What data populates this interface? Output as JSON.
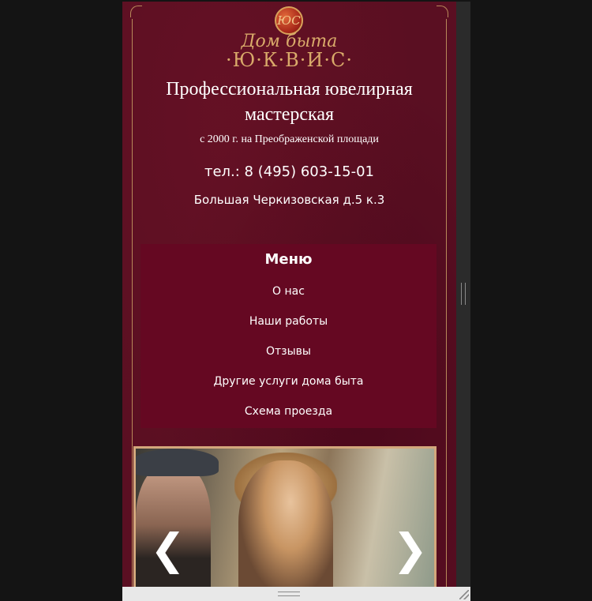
{
  "logo": {
    "monogram": "ЮС",
    "script_text": "Дом быта",
    "brand_text": "·Ю·К·В·И·С·"
  },
  "header": {
    "title": "Профессиональная ювелирная мастерская",
    "subtitle": "с 2000 г. на Преображенской площади",
    "phone": "тел.: 8 (495) 603-15-01",
    "address": "Большая Черкизовская д.5 к.3"
  },
  "menu": {
    "title": "Меню",
    "items": [
      {
        "label": "О нас"
      },
      {
        "label": "Наши работы"
      },
      {
        "label": "Отзывы"
      },
      {
        "label": "Другие услуги дома быта"
      },
      {
        "label": "Схема проезда"
      }
    ]
  },
  "slider": {
    "prev_glyph": "❮",
    "next_glyph": "❯",
    "prev_icon": "chevron-left-icon",
    "next_icon": "chevron-right-icon"
  },
  "colors": {
    "page_background": "#5a0f22",
    "menu_background": "#650822",
    "gold_accent": "#d9aa6a",
    "text": "#ffffff"
  }
}
